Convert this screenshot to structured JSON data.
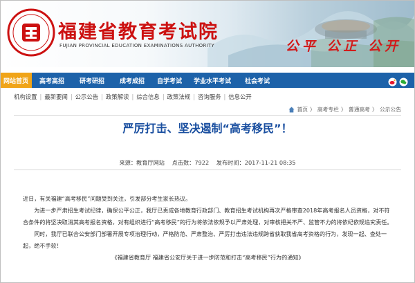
{
  "header": {
    "site_title": "福建省教育考试院",
    "site_subtitle": "FUJIAN PROVINCIAL EDUCATION EXAMINATIONS AUTHORITY",
    "slogan": "公平 公正 公开"
  },
  "main_nav": [
    {
      "label": "网站首页",
      "active": true
    },
    {
      "label": "高考高招",
      "active": false
    },
    {
      "label": "研考研招",
      "active": false
    },
    {
      "label": "成考成招",
      "active": false
    },
    {
      "label": "自学考试",
      "active": false
    },
    {
      "label": "学业水平考试",
      "active": false
    },
    {
      "label": "社会考试",
      "active": false
    }
  ],
  "sub_nav": [
    "机构设置",
    "最新要闻",
    "公示公告",
    "政策解读",
    "综合信息",
    "政策法规",
    "咨询服务",
    "信息公开"
  ],
  "breadcrumb": [
    "首页",
    "高考专栏",
    "普通高考",
    "公示公告"
  ],
  "article": {
    "title": "严厉打击、坚决遏制“高考移民”！",
    "meta": {
      "source": "来源：教育厅网站",
      "views": "点击数：7922",
      "published": "发布时间：2017-11-21 08:35"
    },
    "paragraphs": [
      "近日，有关福建“高考移民”问题受到关注，引发部分考生家长热议。",
      "为进一步严肃招生考试纪律，确保公平公正，我厅已责成各地教育行政部门、教育招生考试机构再次严格审查2018年高考报名人员资格，对不符合条件的将坚决取消其高考报名资格，对有组织进行“高考移民”的行为将依法依规予以严肃处理，对审核把关不严、监管不力的将依纪依规追究责任。",
      "同时，我厅已联合公安部门部署开展专项治理行动，严格防范、严肃整治、严厉打击违法违规跨省获取我省高考资格的行为，发现一起、查处一起，绝不手软！"
    ],
    "related_link": "《福建省教育厅 福建省公安厅关于进一步防范和打击“高考移民”行为的通知》"
  },
  "colors": {
    "title_red": "#cc1111",
    "nav_blue": "#1d62a9",
    "nav_active": "#f0a418",
    "article_title_blue": "#1a4fa0"
  }
}
